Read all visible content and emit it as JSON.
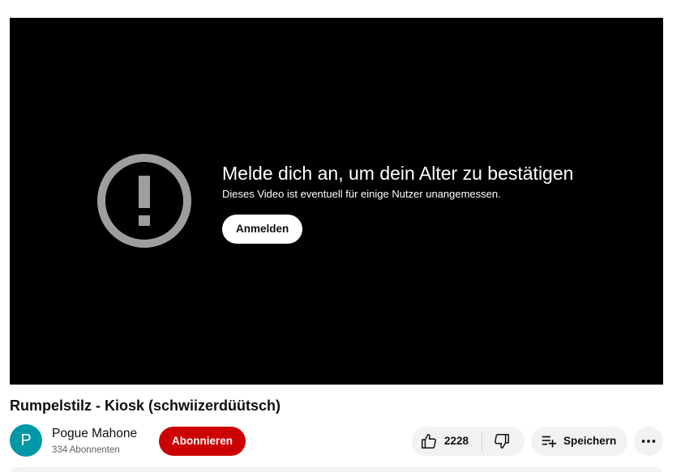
{
  "player": {
    "gate_title": "Melde dich an, um dein Alter zu bestätigen",
    "gate_subtitle": "Dieses Video ist eventuell für einige Nutzer unangemessen.",
    "signin_label": "Anmelden",
    "icon": "alert-circle-icon"
  },
  "video": {
    "title": "Rumpelstilz - Kiosk (schwiizerdüütsch)"
  },
  "channel": {
    "avatar_letter": "P",
    "avatar_color": "#0097a7",
    "name": "Pogue Mahone",
    "subscribers": "334 Abonnenten",
    "subscribe_label": "Abonnieren",
    "subscribe_color": "#cc0000"
  },
  "actions": {
    "like_count": "2228",
    "like_icon": "thumbs-up-icon",
    "dislike_icon": "thumbs-down-icon",
    "save_label": "Speichern",
    "save_icon": "playlist-add-icon",
    "more_icon": "more-horizontal-icon"
  }
}
